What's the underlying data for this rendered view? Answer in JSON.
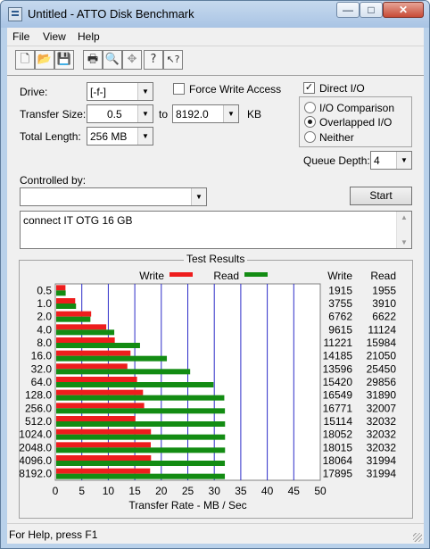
{
  "window": {
    "title": "Untitled - ATTO Disk Benchmark",
    "controls": [
      "—",
      "□",
      "✕"
    ]
  },
  "menu": [
    "File",
    "View",
    "Help"
  ],
  "toolbar": {
    "icons": [
      "new-document-icon",
      "open-folder-icon",
      "save-icon",
      "print-icon",
      "print-preview-icon",
      "move-icon",
      "help-icon",
      "context-help-icon"
    ],
    "glyphs": [
      "🗋",
      "📂",
      "💾",
      "🖶",
      "🔍",
      "✥",
      "?",
      "↖?"
    ]
  },
  "settings": {
    "drive_label": "Drive:",
    "drive_value": "[-f-]",
    "transfer_size_label": "Transfer Size:",
    "transfer_size_from": "0.5",
    "transfer_size_to_label": "to",
    "transfer_size_to": "8192.0",
    "transfer_size_unit": "KB",
    "total_length_label": "Total Length:",
    "total_length_value": "256 MB",
    "force_write_access_label": "Force Write Access",
    "force_write_access_checked": false,
    "direct_io_label": "Direct I/O",
    "direct_io_checked": true,
    "io_comparison_label": "I/O Comparison",
    "overlapped_io_label": "Overlapped I/O",
    "neither_label": "Neither",
    "selected_mode": "Overlapped I/O",
    "queue_depth_label": "Queue Depth:",
    "queue_depth_value": "4",
    "controlled_by_label": "Controlled by:",
    "controlled_by_value": "",
    "start_button": "Start",
    "description": "connect IT OTG 16 GB"
  },
  "chart_data": {
    "type": "bar",
    "title": "Test Results",
    "xlabel": "Transfer Rate - MB / Sec",
    "xlim": [
      0,
      50
    ],
    "xticks": [
      "0",
      "5",
      "10",
      "15",
      "20",
      "25",
      "30",
      "35",
      "40",
      "45",
      "50"
    ],
    "categories": [
      "0.5",
      "1.0",
      "2.0",
      "4.0",
      "8.0",
      "16.0",
      "32.0",
      "64.0",
      "128.0",
      "256.0",
      "512.0",
      "1024.0",
      "2048.0",
      "4096.0",
      "8192.0"
    ],
    "series": [
      {
        "name": "Write",
        "color": "#ee1d1d",
        "values": [
          1.915,
          3.755,
          6.762,
          9.615,
          11.221,
          14.185,
          13.596,
          15.42,
          16.549,
          16.771,
          15.114,
          18.052,
          18.015,
          18.064,
          17.895
        ]
      },
      {
        "name": "Read",
        "color": "#138c13",
        "values": [
          1.955,
          3.91,
          6.622,
          11.124,
          15.984,
          21.05,
          25.45,
          29.856,
          31.89,
          32.007,
          32.032,
          32.032,
          32.032,
          31.994,
          31.994
        ]
      }
    ],
    "table_headers": [
      "Write",
      "Read"
    ],
    "write_column": [
      "1915",
      "3755",
      "6762",
      "9615",
      "11221",
      "14185",
      "13596",
      "15420",
      "16549",
      "16771",
      "15114",
      "18052",
      "18015",
      "18064",
      "17895"
    ],
    "read_column": [
      "1955",
      "3910",
      "6622",
      "11124",
      "15984",
      "21050",
      "25450",
      "29856",
      "31890",
      "32007",
      "32032",
      "32032",
      "32032",
      "31994",
      "31994"
    ],
    "legend_placement": "top"
  },
  "status": {
    "text": "For Help, press F1"
  },
  "colors": {
    "write": "#ee1d1d",
    "read": "#138c13",
    "gridline": "#2c2cc8",
    "window_chrome": "#b9d1ea"
  }
}
